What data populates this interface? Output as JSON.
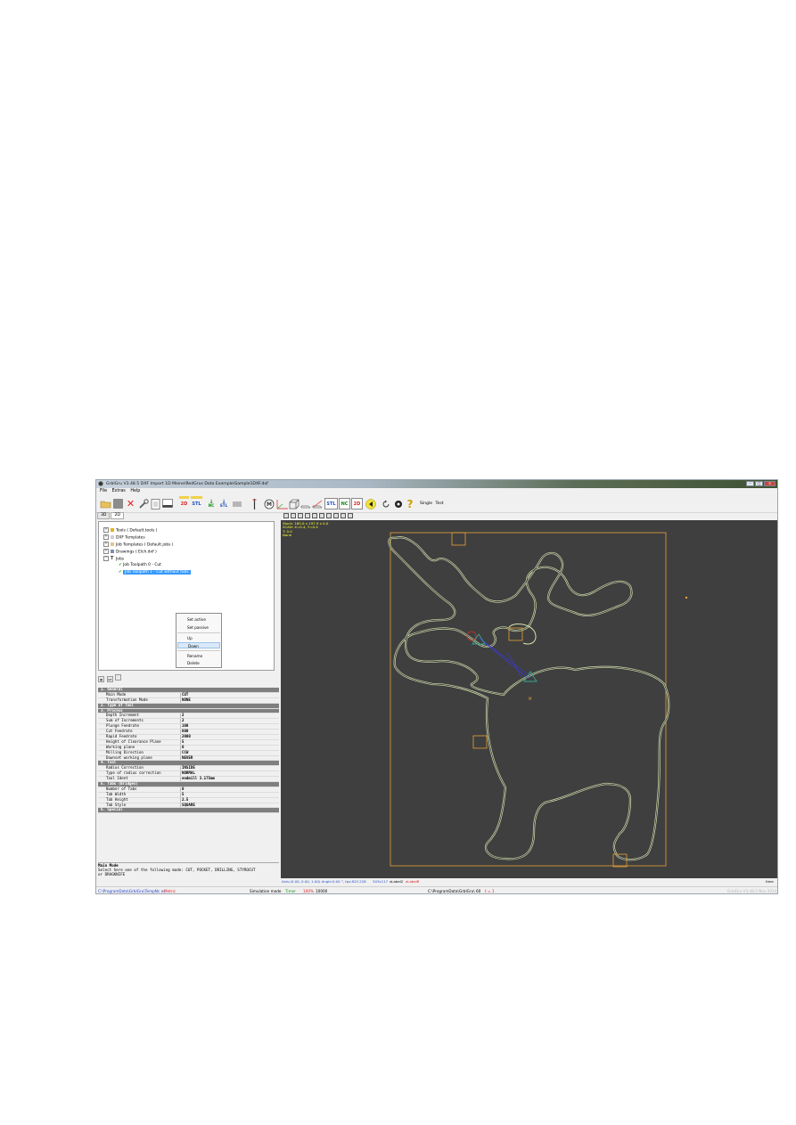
{
  "window": {
    "title": "GrblGru V3.48.5     DXF Import 1D        Meine\\RedGrus Data Example\\Sample1DXF.dxf"
  },
  "menu": [
    "File",
    "Extras",
    "Help"
  ],
  "toolbar": {
    "btn_2d_label": "2D",
    "btn_stl_label": "STL",
    "btn_nc_label": "NC",
    "btn_stl_down_label": "STL",
    "btn_stl2_label": "STL",
    "btn_nc2_label": "NC",
    "btn_2d2_label": "2D",
    "single_label": "Single",
    "test_label": "Test"
  },
  "view_tabs": [
    "3D",
    "2D"
  ],
  "tree": {
    "tools": "Tools  ( Default.tools )",
    "dxf_templates": "DXF Templates",
    "job_templates": "Job Templates  ( Default.jobs )",
    "drawings": "Drawings  ( Elch.dxf )",
    "jobs": "Jobs",
    "job0": "Job Toolpath 0 - Cut",
    "job1": "Job Toolpath 1 - Cut without tabs"
  },
  "context_menu": {
    "set_active": "Set active",
    "set_passive": "Set passive",
    "up": "Up",
    "down": "Down",
    "rename": "Rename",
    "delete": "Delete"
  },
  "grid": [
    {
      "cat": true,
      "k": "1. General",
      "v": ""
    },
    {
      "k": "Main Mode",
      "v": "CUT"
    },
    {
      "k": "Transformation Mode",
      "v": "NONE"
    },
    {
      "cat": true,
      "k": "2. Type of Tool",
      "v": ""
    },
    {
      "cat": true,
      "k": "3. Process",
      "v": ""
    },
    {
      "k": "Depth Increment",
      "v": "2"
    },
    {
      "k": "Sum of Increments",
      "v": "2"
    },
    {
      "k": "Plunge Feedrate",
      "v": "100"
    },
    {
      "k": "Cut Feedrate",
      "v": "800"
    },
    {
      "k": "Rapid Feedrate",
      "v": "2000"
    },
    {
      "k": "Height of Clearance Plane",
      "v": "5"
    },
    {
      "k": "Working plane",
      "v": "0"
    },
    {
      "k": "Milling Direction",
      "v": "CCW"
    },
    {
      "k": "Downset working plane",
      "v": "NEVER"
    },
    {
      "cat": true,
      "k": "4. Tool",
      "v": ""
    },
    {
      "k": "Radius Correction",
      "v": "INSIDE"
    },
    {
      "k": "Type of radius correction",
      "v": "NORMAL"
    },
    {
      "k": "Tool Ident",
      "v": "endmill 3.175mm"
    },
    {
      "cat": true,
      "k": "5. Tabs (Bridges)",
      "v": ""
    },
    {
      "k": "Number of Tabs",
      "v": "0"
    },
    {
      "k": "Tab Width",
      "v": "5"
    },
    {
      "k": "Tab Height",
      "v": "2.5"
    },
    {
      "k": "Tab Style",
      "v": "SQUARE"
    },
    {
      "cat": true,
      "k": "6. Special",
      "v": ""
    }
  ],
  "help": {
    "title": "Main Mode",
    "text1": "Select here one of the following mode: CUT, POCKET, DRILLING, STYROCUT",
    "text2": "or DRAGKNIFE"
  },
  "viewport_info": {
    "line1": "Stock: 160.0 x 197.9 x 0.0",
    "line2": "SCAN: X=0.4, Y=0.4",
    "line3": "T: 0.0",
    "line4": "None"
  },
  "viewport_status": {
    "axes": "Axis:(0.00, 0.00, 1.00)  Angle:0.00 °, fps:825.228",
    "size": "303x117",
    "label2": "xLabel2",
    "label8": "xLabel8",
    "time": "time"
  },
  "statusbar": {
    "path": "C:\\ProgramData\\GrblGru\\TempNc.nc",
    "units": "Metric",
    "sim": "Simulation mode",
    "timer": "Timer",
    "speed": "100%",
    "count": "10000",
    "dir": "C:\\ProgramData\\GrblGru\\ 60",
    "t": "t = 1",
    "version": "GrblGru V3.48.5 Nov 2014"
  },
  "colors": {
    "viewport_bg": "#3f3f3f",
    "stock_outline": "#e8a33a",
    "toolpath": "#d6e4b0",
    "info_text": "#ffff33",
    "selection": "#3399ff"
  }
}
